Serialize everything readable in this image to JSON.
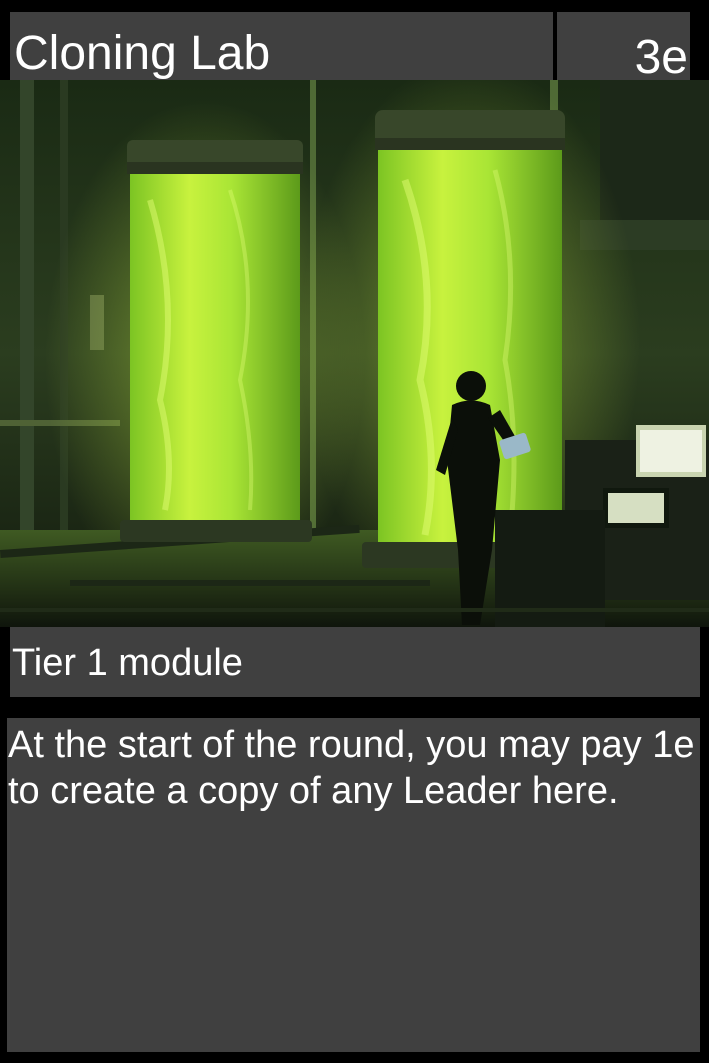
{
  "card": {
    "title": "Cloning Lab",
    "cost": "3e",
    "type_line": "Tier 1 module",
    "rules_text": "At the start of the round, you may pay 1e to create a copy of any Leader here."
  },
  "artwork": {
    "subject": "cloning-vats-illustration"
  },
  "colors": {
    "panel_background": "#404040",
    "card_border": "#000000",
    "text": "#ffffff",
    "vat_liquid": "#a8e63a"
  }
}
